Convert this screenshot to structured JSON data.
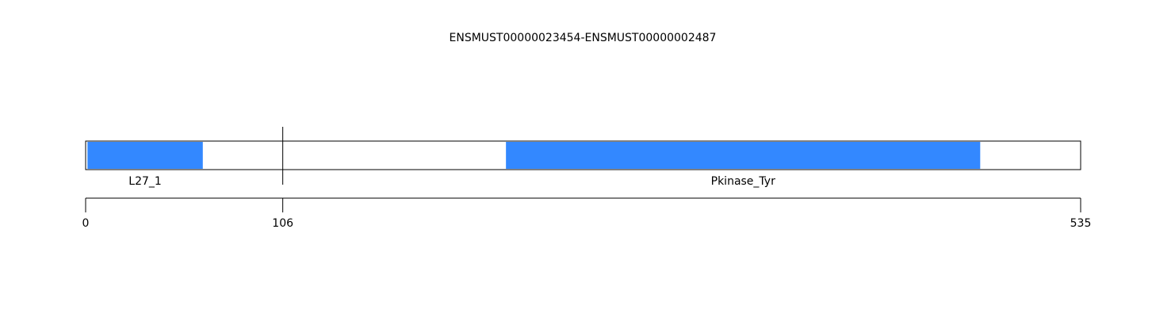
{
  "title": "ENSMUST00000023454-ENSMUST00000002487",
  "sequence_length": 535,
  "breakpoint": 106,
  "colors": {
    "domain_fill": "#3388ff",
    "outline": "#000000",
    "background": "#ffffff"
  },
  "domains": [
    {
      "name": "L27_1",
      "start": 1,
      "end": 63
    },
    {
      "name": "Pkinase_Tyr",
      "start": 226,
      "end": 481
    }
  ],
  "axis": {
    "ticks": [
      {
        "value": 0,
        "label": "0"
      },
      {
        "value": 106,
        "label": "106"
      },
      {
        "value": 535,
        "label": "535"
      }
    ]
  }
}
